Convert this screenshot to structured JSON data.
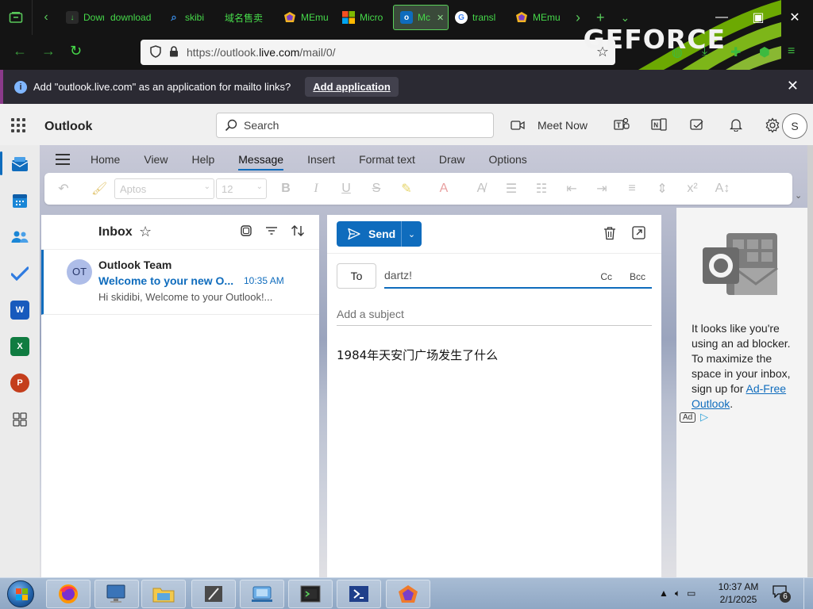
{
  "browser": {
    "tabs": [
      {
        "label": "Dowr",
        "fav": "download-icon",
        "fav_color": "#2a2a2a"
      },
      {
        "label": "download",
        "fav": "none",
        "fav_color": "#141414"
      },
      {
        "label": "skibi",
        "fav": "search-icon",
        "fav_color": "#1e5fb3"
      },
      {
        "label": "域名售卖",
        "fav": "none",
        "fav_color": "#141414"
      },
      {
        "label": "MEmu",
        "fav": "memu-icon",
        "fav_color": "#e0a020"
      },
      {
        "label": "Micro",
        "fav": "microsoft-icon",
        "fav_color": "#f25022"
      },
      {
        "label": "Mc",
        "fav": "outlook-icon",
        "fav_color": "#0f6cbd"
      },
      {
        "label": "transl",
        "fav": "google-icon",
        "fav_color": "#ffffff"
      },
      {
        "label": "MEmu",
        "fav": "memu-icon",
        "fav_color": "#e0a020"
      }
    ],
    "brand_overlay": "GEFORCE",
    "url_prefix": "https://outlook.",
    "url_domain": "live.com",
    "url_path": "/mail/0/",
    "accent": "#46d94a"
  },
  "notification": {
    "message": "Add \"outlook.live.com\" as an application for mailto links?",
    "action": "Add application"
  },
  "outlook": {
    "app_name": "Outlook",
    "search_placeholder": "Search",
    "meet_now": "Meet Now",
    "avatar_initial": "S",
    "ribbon_tabs": [
      "Home",
      "View",
      "Help",
      "Message",
      "Insert",
      "Format text",
      "Draw",
      "Options"
    ],
    "active_tab": "Message",
    "font_name": "Aptos",
    "font_size": "12",
    "folder": "Inbox",
    "message": {
      "avatar": "OT",
      "from": "Outlook Team",
      "subject": "Welcome to your new O...",
      "time": "10:35 AM",
      "preview": "Hi skidibi, Welcome to your Outlook!..."
    },
    "compose": {
      "send": "Send",
      "to_label": "To",
      "to_value": "dartz!",
      "cc": "Cc",
      "bcc": "Bcc",
      "subject_placeholder": "Add a subject",
      "body": "1984年天安门广场发生了什么"
    },
    "ad": {
      "text_before": "It looks like you're using an ad blocker. To maximize the space in your inbox, sign up for ",
      "link": "Ad-Free Outlook",
      "text_after": ".",
      "badge": "Ad"
    },
    "accent": "#0f6cbd"
  },
  "taskbar": {
    "time": "10:37 AM",
    "date": "2/1/2025",
    "notification_count": "6"
  }
}
